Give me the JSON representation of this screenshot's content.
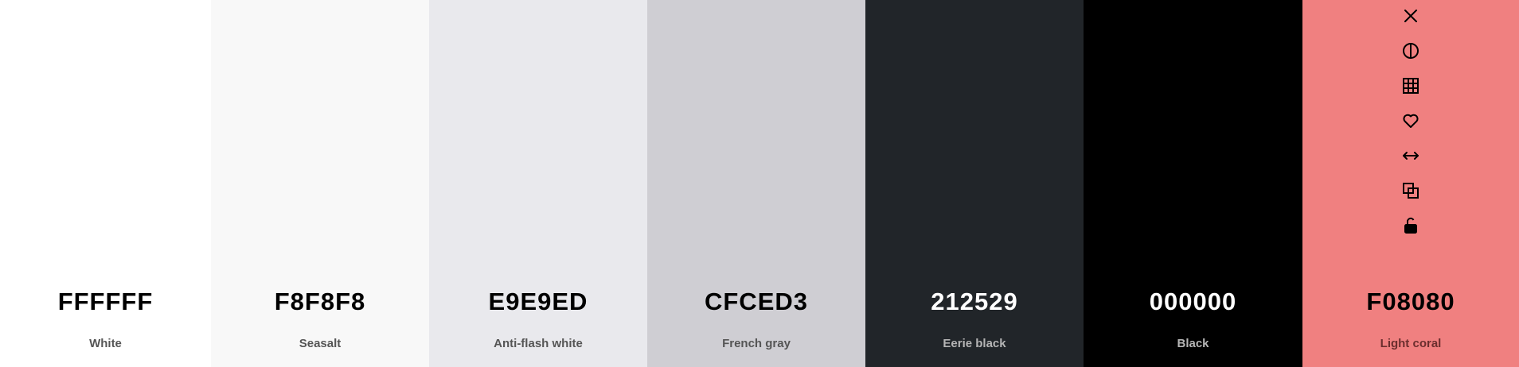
{
  "palette": {
    "swatches": [
      {
        "hex": "FFFFFF",
        "name": "White",
        "bg": "#FFFFFF",
        "text_color": "#000000",
        "name_color": "#555555"
      },
      {
        "hex": "F8F8F8",
        "name": "Seasalt",
        "bg": "#F8F8F8",
        "text_color": "#000000",
        "name_color": "#555555"
      },
      {
        "hex": "E9E9ED",
        "name": "Anti-flash white",
        "bg": "#E9E9ED",
        "text_color": "#000000",
        "name_color": "#555555"
      },
      {
        "hex": "CFCED3",
        "name": "French gray",
        "bg": "#CFCED3",
        "text_color": "#000000",
        "name_color": "#555555"
      },
      {
        "hex": "212529",
        "name": "Eerie black",
        "bg": "#212529",
        "text_color": "#FFFFFF",
        "name_color": "#B5B5B5"
      },
      {
        "hex": "000000",
        "name": "Black",
        "bg": "#000000",
        "text_color": "#FFFFFF",
        "name_color": "#B5B5B5"
      },
      {
        "hex": "F08080",
        "name": "Light coral",
        "bg": "#F08080",
        "text_color": "#000000",
        "name_color": "#6B2E2E"
      }
    ]
  },
  "tools": {
    "icons": [
      "close-icon",
      "contrast-icon",
      "grid-icon",
      "heart-icon",
      "swap-horizontal-icon",
      "copy-icon",
      "unlock-icon"
    ],
    "icon_color": "#000000"
  }
}
